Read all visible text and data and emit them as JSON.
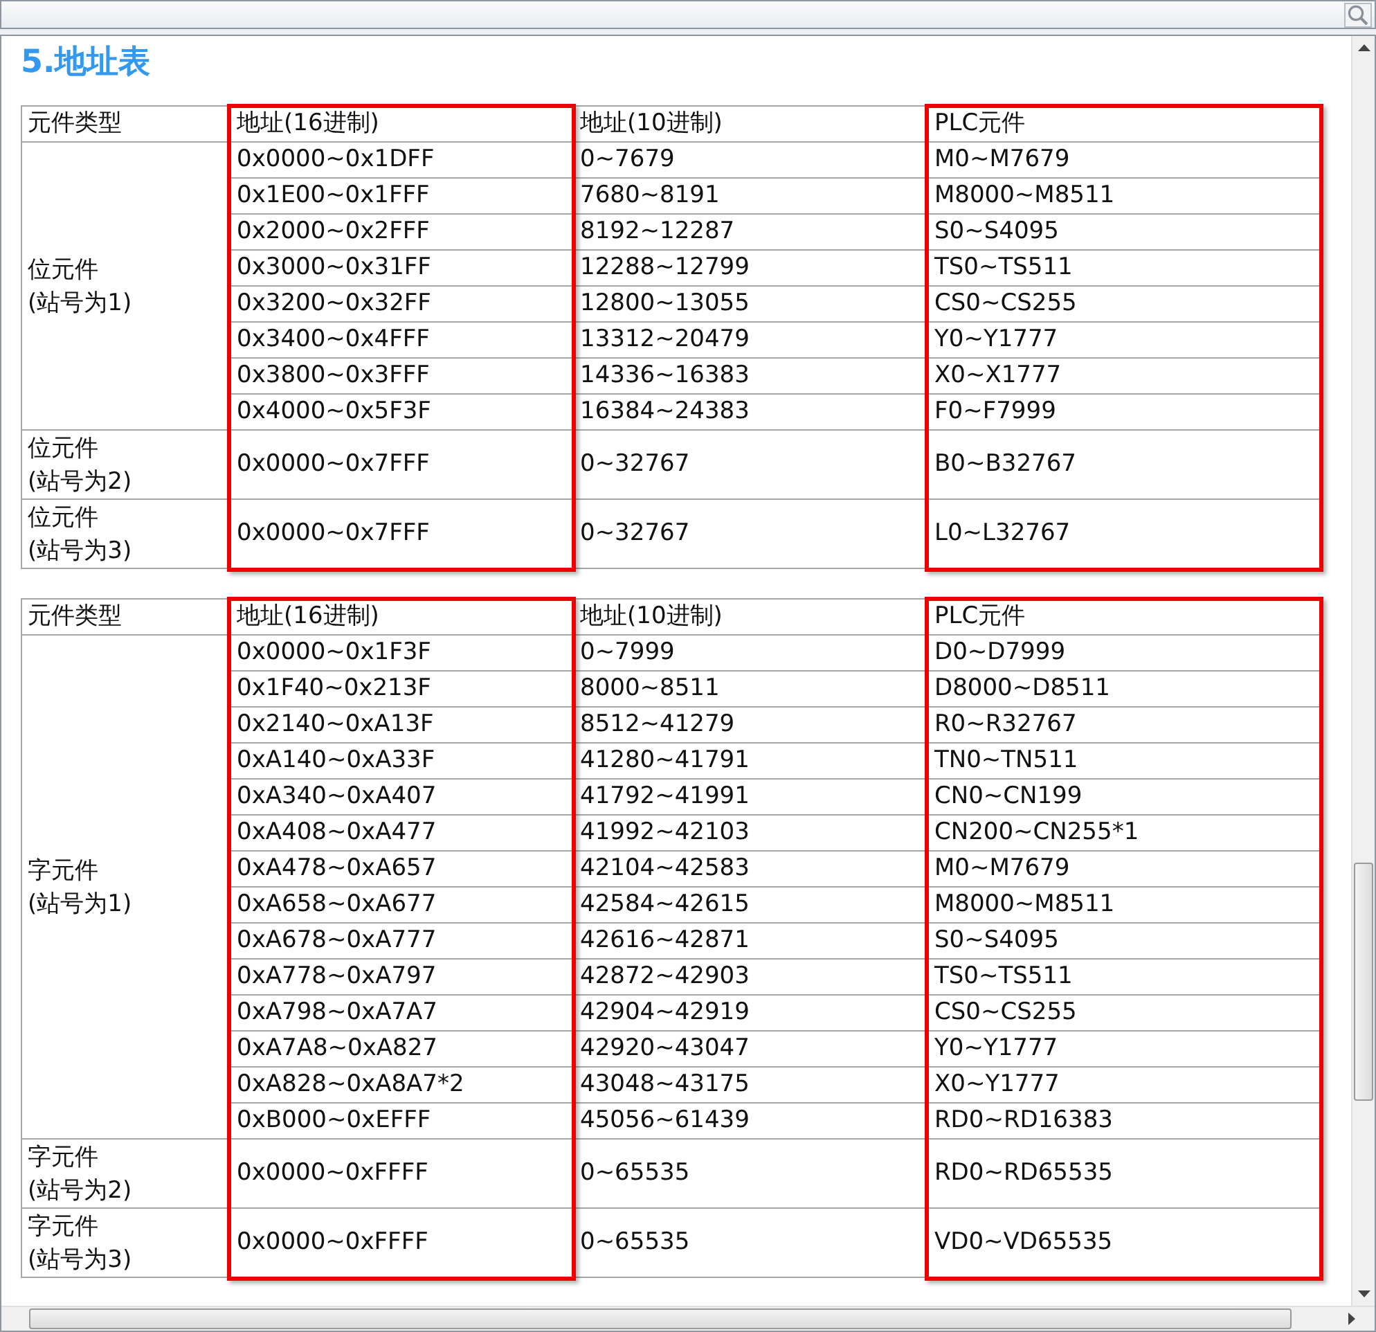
{
  "heading": "5.地址表",
  "tables": [
    {
      "columns": [
        {
          "label": "元件类型",
          "highlighted": false
        },
        {
          "label": "地址(16进制)",
          "highlighted": true
        },
        {
          "label": "地址(10进制)",
          "highlighted": false
        },
        {
          "label": "PLC元件",
          "highlighted": true
        }
      ],
      "groups": [
        {
          "type": "位元件\n(站号为1)",
          "rows": [
            [
              "0x0000~0x1DFF",
              "0~7679",
              "M0~M7679"
            ],
            [
              "0x1E00~0x1FFF",
              "7680~8191",
              "M8000~M8511"
            ],
            [
              "0x2000~0x2FFF",
              "8192~12287",
              "S0~S4095"
            ],
            [
              "0x3000~0x31FF",
              "12288~12799",
              "TS0~TS511"
            ],
            [
              "0x3200~0x32FF",
              "12800~13055",
              "CS0~CS255"
            ],
            [
              "0x3400~0x4FFF",
              "13312~20479",
              "Y0~Y1777"
            ],
            [
              "0x3800~0x3FFF",
              "14336~16383",
              "X0~X1777"
            ],
            [
              "0x4000~0x5F3F",
              "16384~24383",
              "F0~F7999"
            ]
          ]
        },
        {
          "type": "位元件\n(站号为2)",
          "rows": [
            [
              "0x0000~0x7FFF",
              "0~32767",
              "B0~B32767"
            ]
          ]
        },
        {
          "type": "位元件\n(站号为3)",
          "rows": [
            [
              "0x0000~0x7FFF",
              "0~32767",
              "L0~L32767"
            ]
          ]
        }
      ]
    },
    {
      "columns": [
        {
          "label": "元件类型",
          "highlighted": false
        },
        {
          "label": "地址(16进制)",
          "highlighted": true
        },
        {
          "label": "地址(10进制)",
          "highlighted": false
        },
        {
          "label": "PLC元件",
          "highlighted": true
        }
      ],
      "groups": [
        {
          "type": "字元件\n(站号为1)",
          "rows": [
            [
              "0x0000~0x1F3F",
              "0~7999",
              "D0~D7999"
            ],
            [
              "0x1F40~0x213F",
              "8000~8511",
              "D8000~D8511"
            ],
            [
              "0x2140~0xA13F",
              "8512~41279",
              "R0~R32767"
            ],
            [
              "0xA140~0xA33F",
              "41280~41791",
              "TN0~TN511"
            ],
            [
              "0xA340~0xA407",
              "41792~41991",
              "CN0~CN199"
            ],
            [
              "0xA408~0xA477",
              "41992~42103",
              "CN200~CN255*1"
            ],
            [
              "0xA478~0xA657",
              "42104~42583",
              "M0~M7679"
            ],
            [
              "0xA658~0xA677",
              "42584~42615",
              "M8000~M8511"
            ],
            [
              "0xA678~0xA777",
              "42616~42871",
              "S0~S4095"
            ],
            [
              "0xA778~0xA797",
              "42872~42903",
              "TS0~TS511"
            ],
            [
              "0xA798~0xA7A7",
              "42904~42919",
              "CS0~CS255"
            ],
            [
              "0xA7A8~0xA827",
              "42920~43047",
              "Y0~Y1777"
            ],
            [
              "0xA828~0xA8A7*2",
              "43048~43175",
              "X0~Y1777"
            ],
            [
              "0xB000~0xEFFF",
              "45056~61439",
              "RD0~RD16383"
            ]
          ]
        },
        {
          "type": "字元件\n(站号为2)",
          "rows": [
            [
              "0x0000~0xFFFF",
              "0~65535",
              "RD0~RD65535"
            ]
          ]
        },
        {
          "type": "字元件\n(站号为3)",
          "rows": [
            [
              "0x0000~0xFFFF",
              "0~65535",
              "VD0~VD65535"
            ]
          ]
        }
      ]
    }
  ]
}
